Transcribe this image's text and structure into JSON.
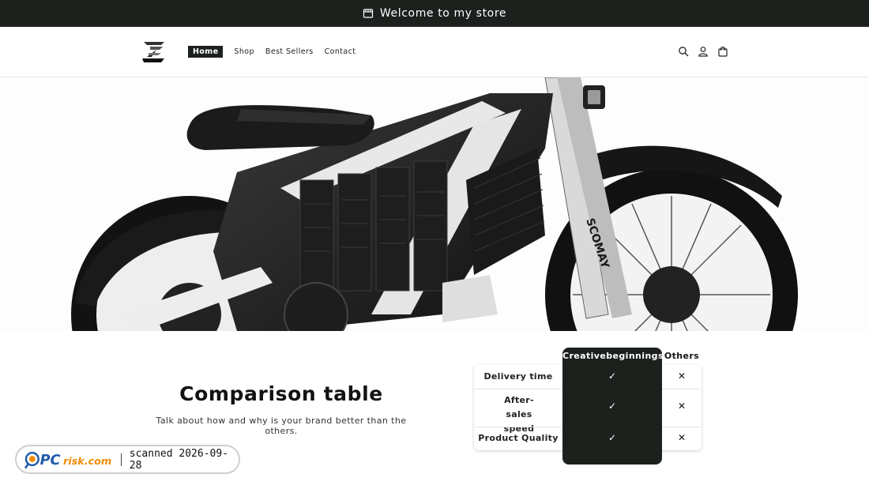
{
  "announcement": {
    "text": "Welcome to my store",
    "icon": "store-icon"
  },
  "header": {
    "logo_alt": "store-logo",
    "nav": [
      {
        "label": "Home",
        "active": true
      },
      {
        "label": "Shop",
        "active": false
      },
      {
        "label": "Best Sellers",
        "active": false
      },
      {
        "label": "Contact",
        "active": false
      }
    ],
    "icons": [
      "search-icon",
      "account-icon",
      "cart-icon"
    ]
  },
  "hero": {
    "image": "electric-motorbike"
  },
  "comparison": {
    "title": "Comparison table",
    "subtitle": "Talk about how and why is your brand better than the others.",
    "brand_column": "Creativebeginnings",
    "others_column": "Others",
    "rows": [
      {
        "label": "Delivery time",
        "brand": "✓",
        "others": "✕"
      },
      {
        "label": "After-sales speed",
        "brand": "✓",
        "others": "✕"
      },
      {
        "label": "Product Quality",
        "brand": "✓",
        "others": "✕"
      }
    ]
  },
  "badge": {
    "brand": "PCrisk.com",
    "scan_text": "scanned 2026-09-28"
  },
  "colors": {
    "dark": "#1c211d",
    "badge_blue": "#1e5aa8",
    "badge_orange": "#f08a00"
  }
}
